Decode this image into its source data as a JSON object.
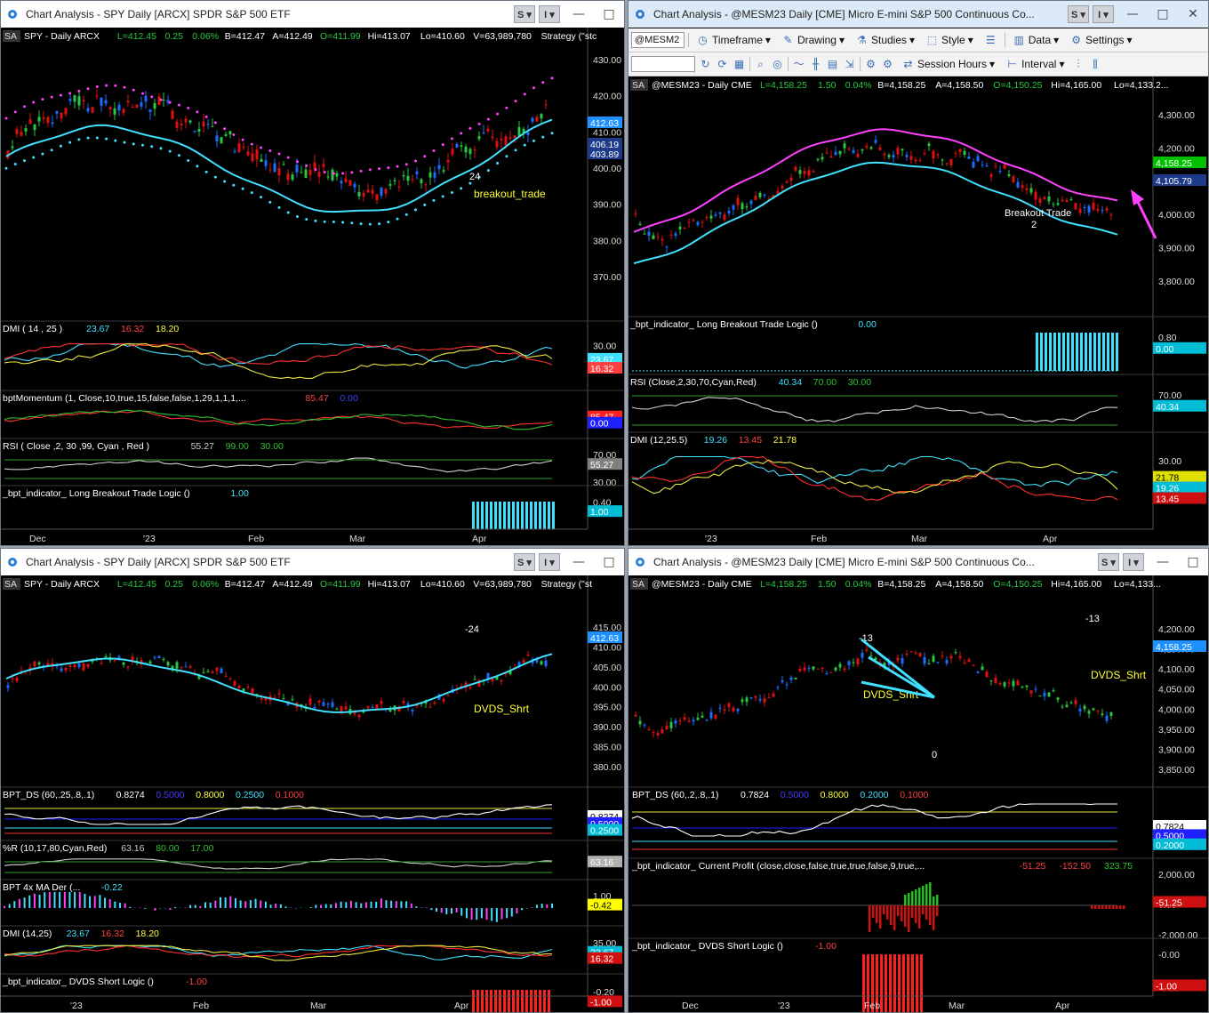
{
  "windows": [
    {
      "id": "w1",
      "title": "Chart Analysis - SPY Daily [ARCX] SPDR S&P 500 ETF",
      "symbol_header": {
        "tag": "SA",
        "symbol": "SPY - Daily  ARCX",
        "last": "L=412.45",
        "chg": "0.25",
        "pct": "0.06%",
        "bid": "B=412.47",
        "ask": "A=412.49",
        "open": "O=411.99",
        "hi": "Hi=413.07",
        "lo": "Lo=410.60",
        "vol": "V=63,989,780",
        "strategy": "Strategy (\"stc"
      },
      "price_labels": [
        "430.00",
        "420.00",
        "410.00",
        "400.00",
        "390.00",
        "380.00",
        "370.00"
      ],
      "price_flags": [
        {
          "text": "412.63",
          "color": "#1e90ff"
        },
        {
          "text": "406.19",
          "color": "#1e3a8a"
        },
        {
          "text": "403.89",
          "color": "#1e3a8a"
        }
      ],
      "annotations": [
        {
          "text": "24",
          "color": "#ffffff"
        },
        {
          "text": "breakout_trade",
          "color": "#ffff33"
        }
      ],
      "panes": [
        {
          "label": "DMI ( 14 , 25 )",
          "values": [
            {
              "t": "23.67",
              "c": "#40e0ff"
            },
            {
              "t": "16.32",
              "c": "#ff4040"
            },
            {
              "t": "18.20",
              "c": "#ffff40"
            }
          ],
          "axis": [
            "30.00"
          ],
          "flags": [
            {
              "t": "23.67",
              "c": "#40e0ff"
            },
            {
              "t": "16.32",
              "c": "#ff4040"
            }
          ]
        },
        {
          "label": "bptMomentum (1, Close,10,true,15,false,false,1,29,1,1,1,...",
          "values": [
            {
              "t": "85.47",
              "c": "#ff4040"
            },
            {
              "t": "0.00",
              "c": "#4040ff"
            }
          ],
          "axis": [],
          "flags": [
            {
              "t": "85.47",
              "c": "#ff2020"
            },
            {
              "t": "0.00",
              "c": "#2020ff"
            }
          ]
        },
        {
          "label": "RSI ( Close ,2, 30 ,99, Cyan , Red )",
          "values": [
            {
              "t": "55.27",
              "c": "#cccccc"
            },
            {
              "t": "99.00",
              "c": "#30c030"
            },
            {
              "t": "30.00",
              "c": "#30c030"
            }
          ],
          "axis": [
            "70.00",
            "30.00"
          ],
          "flags": [
            {
              "t": "55.27",
              "c": "#808080"
            }
          ]
        },
        {
          "label": "_bpt_indicator_ Long Breakout Trade Logic ()",
          "values": [
            {
              "t": "1.00",
              "c": "#40e0ff"
            }
          ],
          "axis": [
            "0.40"
          ],
          "flags": [
            {
              "t": "1.00",
              "c": "#00bcd4"
            }
          ]
        }
      ],
      "x_labels": [
        "Dec",
        "'23",
        "Feb",
        "Mar",
        "Apr"
      ]
    },
    {
      "id": "w2",
      "title": "Chart Analysis - @MESM23 Daily [CME] Micro E-mini S&P 500 Continuous Co...",
      "toolbar1": {
        "symbol": "@MESM2",
        "items": [
          "Timeframe",
          "Drawing",
          "Studies",
          "Style",
          "Data",
          "Settings"
        ]
      },
      "toolbar2": {
        "items": [
          "Session Hours",
          "Interval"
        ]
      },
      "symbol_header": {
        "tag": "SA",
        "symbol": "@MESM23 - Daily  CME",
        "last": "L=4,158.25",
        "chg": "1.50",
        "pct": "0.04%",
        "bid": "B=4,158.25",
        "ask": "A=4,158.50",
        "open": "O=4,150.25",
        "hi": "Hi=4,165.00",
        "lo": "Lo=4,133.2..."
      },
      "price_labels": [
        "4,300.00",
        "4,200.00",
        "4,100.00",
        "4,000.00",
        "3,900.00",
        "3,800.00"
      ],
      "price_flags": [
        {
          "text": "4,158.25",
          "color": "#00c000"
        },
        {
          "text": "4,105.79",
          "color": "#1e3a8a"
        }
      ],
      "annotations": [
        {
          "text": "Breakout Trade",
          "color": "#ffffff"
        },
        {
          "text": "2",
          "color": "#ffffff"
        }
      ],
      "panes": [
        {
          "label": "_bpt_indicator_ Long Breakout Trade Logic ()",
          "values": [
            {
              "t": "0.00",
              "c": "#40e0ff"
            }
          ],
          "axis": [
            "0.80"
          ],
          "flags": [
            {
              "t": "0.00",
              "c": "#00bcd4"
            }
          ]
        },
        {
          "label": "RSI (Close,2,30,70,Cyan,Red)",
          "values": [
            {
              "t": "40.34",
              "c": "#40e0ff"
            },
            {
              "t": "70.00",
              "c": "#30c030"
            },
            {
              "t": "30.00",
              "c": "#30c030"
            }
          ],
          "axis": [
            "70.00"
          ],
          "flags": [
            {
              "t": "40.34",
              "c": "#00bcd4"
            }
          ]
        },
        {
          "label": "DMI (12,25.5)",
          "values": [
            {
              "t": "19.26",
              "c": "#40e0ff"
            },
            {
              "t": "13.45",
              "c": "#ff4040"
            },
            {
              "t": "21.78",
              "c": "#ffff40"
            }
          ],
          "axis": [
            "30.00"
          ],
          "flags": [
            {
              "t": "21.78",
              "c": "#e0e000"
            },
            {
              "t": "19.26",
              "c": "#00bcd4"
            },
            {
              "t": "13.45",
              "c": "#d01010"
            }
          ]
        }
      ],
      "x_labels": [
        "'23",
        "Feb",
        "Mar",
        "Apr"
      ]
    },
    {
      "id": "w3",
      "title": "Chart Analysis - SPY Daily [ARCX] SPDR S&P 500 ETF",
      "symbol_header": {
        "tag": "SA",
        "symbol": "SPY - Daily  ARCX",
        "last": "L=412.45",
        "chg": "0.25",
        "pct": "0.06%",
        "bid": "B=412.47",
        "ask": "A=412.49",
        "open": "O=411.99",
        "hi": "Hi=413.07",
        "lo": "Lo=410.60",
        "vol": "V=63,989,780",
        "strategy": "Strategy (\"st"
      },
      "price_labels": [
        "415.00",
        "410.00",
        "405.00",
        "400.00",
        "395.00",
        "390.00",
        "385.00",
        "380.00"
      ],
      "price_flags": [
        {
          "text": "412.63",
          "color": "#1e90ff"
        }
      ],
      "annotations": [
        {
          "text": "-24",
          "color": "#ffffff"
        },
        {
          "text": "DVDS_Shrt",
          "color": "#ffff33"
        }
      ],
      "panes": [
        {
          "label": "BPT_DS (60,.25,.8,.1)",
          "values": [
            {
              "t": "0.8274",
              "c": "#ffffff"
            },
            {
              "t": "0.5000",
              "c": "#4040ff"
            },
            {
              "t": "0.8000",
              "c": "#ffff40"
            },
            {
              "t": "0.2500",
              "c": "#40e0ff"
            },
            {
              "t": "0.1000",
              "c": "#ff4040"
            }
          ],
          "axis": [],
          "flags": [
            {
              "t": "0.8274",
              "c": "#ffffff"
            },
            {
              "t": "0.5000",
              "c": "#2020ff"
            },
            {
              "t": "0.2500",
              "c": "#00bcd4"
            }
          ]
        },
        {
          "label": "%R (10,17,80,Cyan,Red)",
          "values": [
            {
              "t": "63.16",
              "c": "#cccccc"
            },
            {
              "t": "80.00",
              "c": "#30c030"
            },
            {
              "t": "17.00",
              "c": "#30c030"
            }
          ],
          "axis": [],
          "flags": [
            {
              "t": "63.16",
              "c": "#b0b0b0"
            }
          ]
        },
        {
          "label": "BPT 4x MA Der (...",
          "values": [
            {
              "t": "-0.22",
              "c": "#40e0ff"
            }
          ],
          "axis": [
            "1.00"
          ],
          "flags": [
            {
              "t": "-0.42",
              "c": "#ffff00"
            }
          ]
        },
        {
          "label": "DMI (14,25)",
          "values": [
            {
              "t": "23.67",
              "c": "#40e0ff"
            },
            {
              "t": "16.32",
              "c": "#ff4040"
            },
            {
              "t": "18.20",
              "c": "#ffff40"
            }
          ],
          "axis": [
            "35.00"
          ],
          "flags": [
            {
              "t": "23.67",
              "c": "#00bcd4"
            },
            {
              "t": "16.32",
              "c": "#d01010"
            }
          ]
        },
        {
          "label": "_bpt_indicator_ DVDS Short Logic ()",
          "values": [
            {
              "t": "-1.00",
              "c": "#ff4040"
            }
          ],
          "axis": [
            "-0.20"
          ],
          "flags": [
            {
              "t": "-1.00",
              "c": "#d01010"
            }
          ]
        }
      ],
      "x_labels": [
        "'23",
        "Feb",
        "Mar",
        "Apr"
      ]
    },
    {
      "id": "w4",
      "title": "Chart Analysis - @MESM23 Daily [CME] Micro E-mini S&P 500 Continuous Co...",
      "symbol_header": {
        "tag": "SA",
        "symbol": "@MESM23 - Daily  CME",
        "last": "L=4,158.25",
        "chg": "1.50",
        "pct": "0.04%",
        "bid": "B=4,158.25",
        "ask": "A=4,158.50",
        "open": "O=4,150.25",
        "hi": "Hi=4,165.00",
        "lo": "Lo=4,133..."
      },
      "price_labels": [
        "4,200.00",
        "4,150.00",
        "4,100.00",
        "4,050.00",
        "4,000.00",
        "3,950.00",
        "3,900.00",
        "3,850.00"
      ],
      "price_flags": [
        {
          "text": "4,158.25",
          "color": "#1e90ff"
        }
      ],
      "annotations": [
        {
          "text": "-13",
          "color": "#ffffff"
        },
        {
          "text": "-13",
          "color": "#ffffff"
        },
        {
          "text": "DVDS_Shrt",
          "color": "#ffff33"
        },
        {
          "text": "DVDS_Shrt",
          "color": "#ffff33"
        },
        {
          "text": "0",
          "color": "#ffffff"
        }
      ],
      "panes": [
        {
          "label": "BPT_DS (60,.2,.8,.1)",
          "values": [
            {
              "t": "0.7824",
              "c": "#ffffff"
            },
            {
              "t": "0.5000",
              "c": "#4040ff"
            },
            {
              "t": "0.8000",
              "c": "#ffff40"
            },
            {
              "t": "0.2000",
              "c": "#40e0ff"
            },
            {
              "t": "0.1000",
              "c": "#ff4040"
            }
          ],
          "axis": [],
          "flags": [
            {
              "t": "0.7824",
              "c": "#ffffff"
            },
            {
              "t": "0.5000",
              "c": "#2020ff"
            },
            {
              "t": "0.2000",
              "c": "#00bcd4"
            }
          ]
        },
        {
          "label": "_bpt_indicator_ Current Profit (close,close,false,true,true,false,9,true,...",
          "values": [
            {
              "t": "-51.25",
              "c": "#ff4040"
            },
            {
              "t": "-152.50",
              "c": "#ff4040"
            },
            {
              "t": "323.75",
              "c": "#30c030"
            }
          ],
          "axis": [
            "2,000.00",
            "0.00",
            "-2,000.00"
          ],
          "flags": [
            {
              "t": "-51.25",
              "c": "#d01010"
            }
          ]
        },
        {
          "label": "_bpt_indicator_ DVDS Short Logic ()",
          "values": [
            {
              "t": "-1.00",
              "c": "#ff4040"
            }
          ],
          "axis": [
            "-0.00",
            "-0.20",
            "-1.20"
          ],
          "flags": [
            {
              "t": "-1.00",
              "c": "#d01010"
            }
          ]
        }
      ],
      "x_labels": [
        "Dec",
        "'23",
        "Feb",
        "Mar",
        "Apr"
      ]
    }
  ],
  "colors": {
    "up": "#28c840",
    "down": "#e01010",
    "blue_up": "#1e6bff",
    "cyan": "#40e0ff",
    "magenta": "#ff40ff",
    "yellow": "#ffff33"
  }
}
